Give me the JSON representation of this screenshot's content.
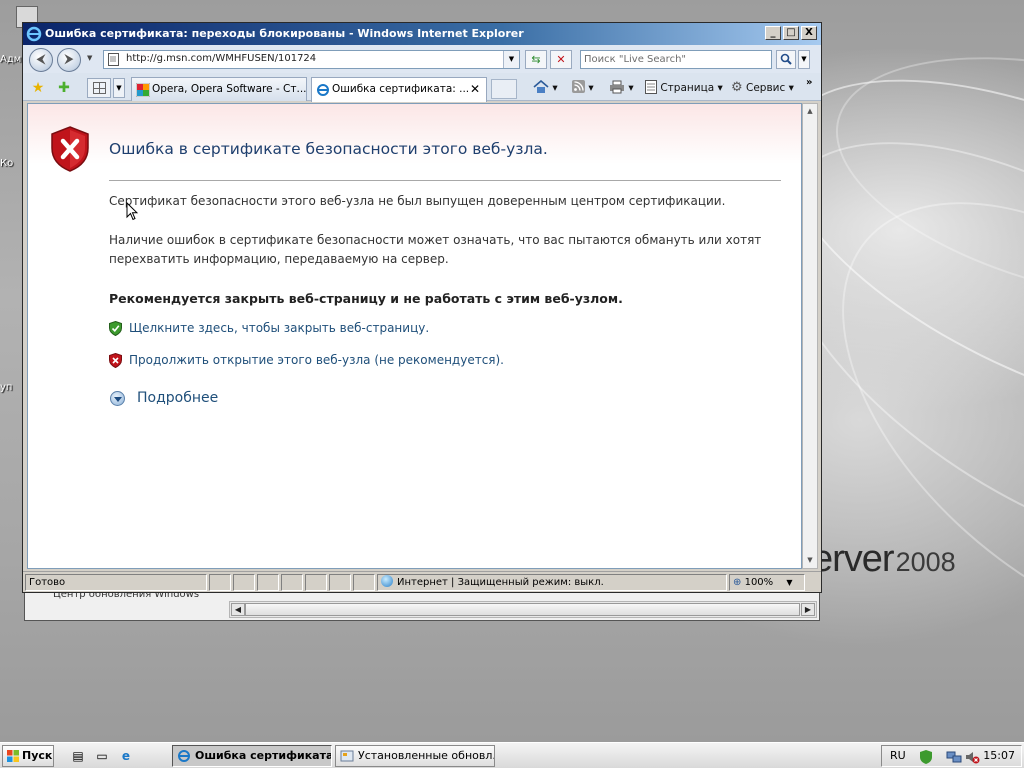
{
  "window": {
    "title": "Ошибка сертификата: переходы блокированы - Windows Internet Explorer",
    "minimize": "_",
    "maximize": "□",
    "close": "X"
  },
  "address": {
    "url": "http://g.msn.com/WMHFUSEN/101724",
    "search_placeholder": "Поиск \"Live Search\""
  },
  "tabs": [
    {
      "label": "Opera, Opera Software - Ст...",
      "icon": "msn-icon",
      "active": false
    },
    {
      "label": "Ошибка сертификата: ...",
      "icon": "ie-icon",
      "active": true
    }
  ],
  "commandbar": {
    "page_label": "Страница",
    "tools_label": "Сервис",
    "chevron": "»"
  },
  "page": {
    "title": "Ошибка в сертификате безопасности этого веб-узла.",
    "para1": "Сертификат безопасности этого веб-узла не был выпущен доверенным центром сертификации.",
    "para2": "Наличие ошибок в сертификате безопасности может означать, что вас пытаются обмануть или хотят перехватить информацию, передаваемую на сервер.",
    "recommendation": "Рекомендуется закрыть веб-страницу и не работать с этим веб-узлом.",
    "close_link": "Щелкните здесь, чтобы закрыть веб-страницу.",
    "continue_link": "Продолжить открытие этого веб-узла (не рекомендуется).",
    "more_info": "Подробнее"
  },
  "statusbar": {
    "status": "Готово",
    "zone": "Интернет | Защищенный режим: выкл.",
    "zoom": "100%"
  },
  "background_window": {
    "text": "Центр обновления Windows"
  },
  "desktop": {
    "brand_main": "erver",
    "brand_year": "2008",
    "icon_labels": [
      "Адм",
      "Ко",
      "уп"
    ]
  },
  "taskbar": {
    "start": "Пуск",
    "tasks": [
      {
        "label": "Ошибка сертификата...",
        "active": true
      },
      {
        "label": "Установленные обновл...",
        "active": false
      }
    ],
    "lang": "RU",
    "clock": "15:07"
  },
  "colors": {
    "title_blue": "#1f3f6e",
    "link_blue": "#1f4f7a",
    "shield_red": "#c0141b",
    "shield_green": "#3d9a2e"
  }
}
